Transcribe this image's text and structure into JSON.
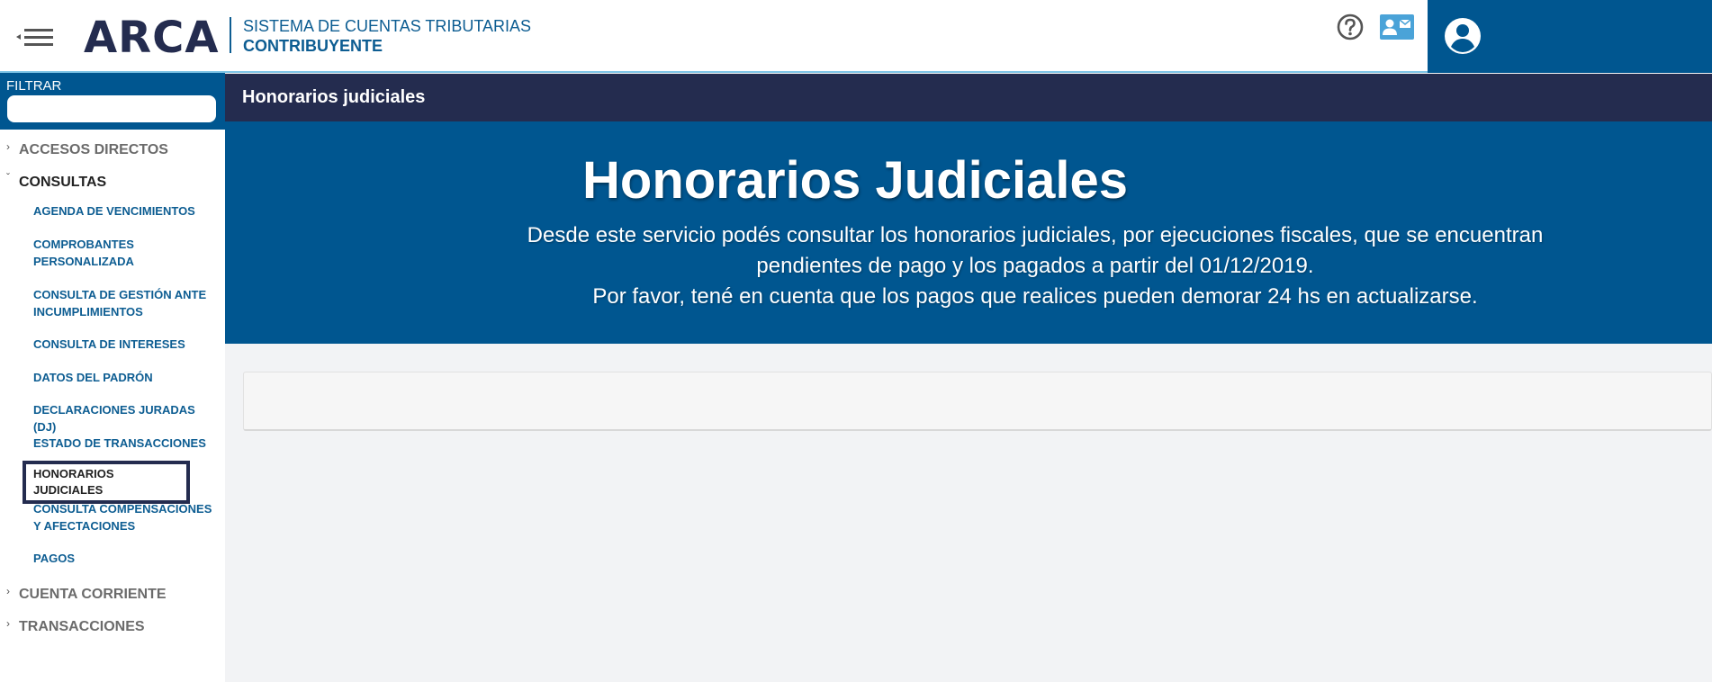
{
  "header": {
    "logo": "ARCA",
    "system_title": "SISTEMA DE CUENTAS TRIBUTARIAS",
    "system_role": "CONTRIBUYENTE",
    "icons": [
      "menu-icon",
      "help-icon",
      "contact-card-icon",
      "user-icon"
    ]
  },
  "sidebar": {
    "filter_label": "FILTRAR",
    "filter_value": "",
    "sections": [
      {
        "label": "ACCESOS DIRECTOS",
        "expanded": false
      },
      {
        "label": "CONSULTAS",
        "expanded": true
      },
      {
        "label": "CUENTA CORRIENTE",
        "expanded": false
      },
      {
        "label": "TRANSACCIONES",
        "expanded": false
      }
    ],
    "consultas_items": [
      "AGENDA DE VENCIMIENTOS",
      "COMPROBANTES PERSONALIZADA",
      "CONSULTA DE GESTIÓN ANTE INCUMPLIMIENTOS",
      "CONSULTA DE INTERESES",
      "DATOS DEL PADRÓN",
      "DECLARACIONES JURADAS (DJ)",
      "ESTADO DE TRANSACCIONES",
      "HONORARIOS JUDICIALES",
      "CONSULTA COMPENSACIONES Y AFECTACIONES",
      "PAGOS"
    ],
    "active_item": "HONORARIOS JUDICIALES",
    "chevrons": {
      "collapsed": "›",
      "expanded": "ˇ"
    }
  },
  "main": {
    "title_bar": "Honorarios judiciales",
    "banner_title": "Honorarios Judiciales",
    "banner_line1": "Desde este servicio podés consultar los honorarios judiciales, por ejecuciones fiscales, que se encuentran",
    "banner_line2": "pendientes de pago y los pagados a partir del 01/12/2019.",
    "banner_line3": "Por favor, tené en cuenta que los pagos que realices pueden demorar 24 hs en actualizarse."
  },
  "colors": {
    "brand_dark": "#242c4f",
    "brand_blue": "#005690",
    "link_blue": "#0d5d92",
    "accent_line": "#7ec4e6"
  }
}
